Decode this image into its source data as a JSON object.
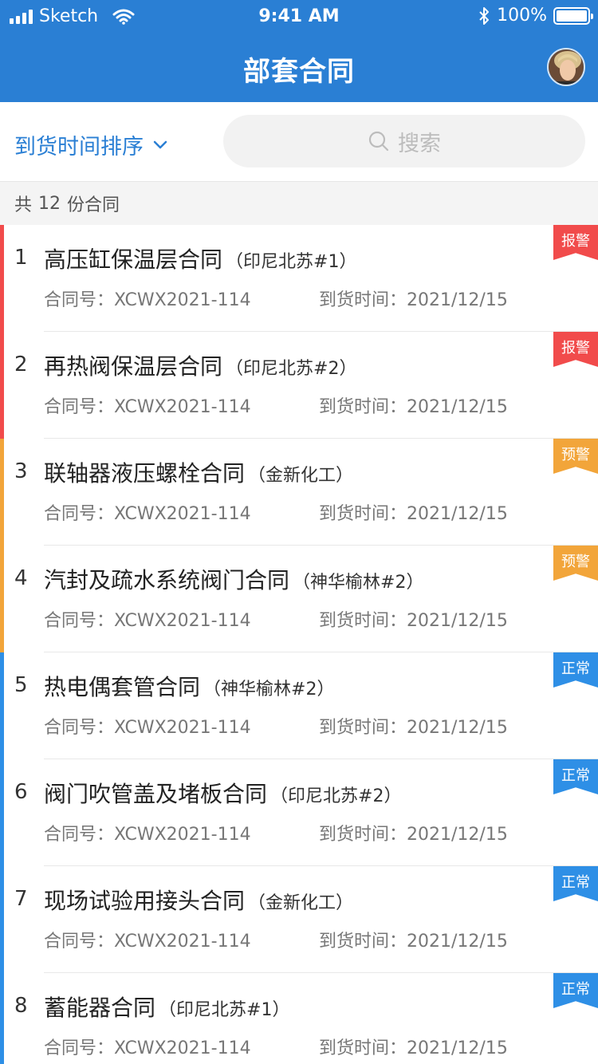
{
  "status_bar": {
    "carrier": "Sketch",
    "time": "9:41 AM",
    "battery": "100%"
  },
  "nav": {
    "title": "部套合同"
  },
  "filter": {
    "sort_label": "到货时间排序",
    "search_placeholder": "搜索"
  },
  "summary": {
    "prefix": "共",
    "count": "12",
    "suffix": "份合同"
  },
  "labels": {
    "contract_no": "合同号：",
    "arrival": "到货时间："
  },
  "colors": {
    "primary": "#2a7fd4",
    "alarm": "#f14b4b",
    "warning": "#f2a53a",
    "normal": "#2e8fe6"
  },
  "contracts": [
    {
      "index": "1",
      "name": "高压缸保温层合同",
      "project": "（印尼北苏#1）",
      "contract_no": "XCWX2021-114",
      "arrival": "2021/12/15",
      "status": "报警",
      "level": "alarm"
    },
    {
      "index": "2",
      "name": "再热阀保温层合同",
      "project": "（印尼北苏#2）",
      "contract_no": "XCWX2021-114",
      "arrival": "2021/12/15",
      "status": "报警",
      "level": "alarm"
    },
    {
      "index": "3",
      "name": "联轴器液压螺栓合同",
      "project": "（金新化工）",
      "contract_no": "XCWX2021-114",
      "arrival": "2021/12/15",
      "status": "预警",
      "level": "warning"
    },
    {
      "index": "4",
      "name": "汽封及疏水系统阀门合同",
      "project": "（神华榆林#2）",
      "contract_no": "XCWX2021-114",
      "arrival": "2021/12/15",
      "status": "预警",
      "level": "warning"
    },
    {
      "index": "5",
      "name": "热电偶套管合同",
      "project": "（神华榆林#2）",
      "contract_no": "XCWX2021-114",
      "arrival": "2021/12/15",
      "status": "正常",
      "level": "normal"
    },
    {
      "index": "6",
      "name": "阀门吹管盖及堵板合同",
      "project": "（印尼北苏#2）",
      "contract_no": "XCWX2021-114",
      "arrival": "2021/12/15",
      "status": "正常",
      "level": "normal"
    },
    {
      "index": "7",
      "name": "现场试验用接头合同",
      "project": "（金新化工）",
      "contract_no": "XCWX2021-114",
      "arrival": "2021/12/15",
      "status": "正常",
      "level": "normal"
    },
    {
      "index": "8",
      "name": "蓄能器合同",
      "project": "（印尼北苏#1）",
      "contract_no": "XCWX2021-114",
      "arrival": "2021/12/15",
      "status": "正常",
      "level": "normal"
    }
  ]
}
